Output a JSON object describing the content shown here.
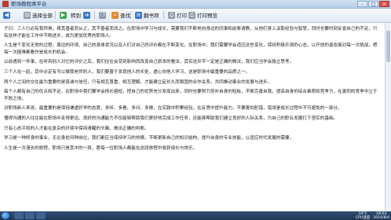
{
  "window": {
    "title": "职场教程类平台",
    "buttons": {
      "minimize": "–",
      "maximize": "□",
      "close": "×"
    }
  },
  "toolbar": {
    "buttons": [
      {
        "label": "",
        "icon": "back-icon"
      },
      {
        "label": "选择全部",
        "icon": "select-all-icon"
      },
      {
        "label": "",
        "icon": "forward-icon"
      },
      {
        "label": "转到",
        "icon": "goto-icon"
      },
      {
        "label": "",
        "icon": "copy-icon"
      },
      {
        "label": "",
        "icon": "search-icon"
      },
      {
        "label": "查找",
        "icon": "find-icon"
      },
      {
        "label": "",
        "icon": "bookmark-icon"
      },
      {
        "label": "翻书项",
        "icon": "page-icon"
      },
      {
        "label": "打印",
        "icon": "print-icon"
      },
      {
        "label": "打印预览",
        "icon": "print-preview-icon"
      }
    ]
  },
  "document": {
    "paragraphs": [
      "子曰：三人行必有我师焉，择其善者而从之，其不善者而改之。在职场中学习与成长，需要我们不断地向身边的同事和前辈请教，从他们身上汲取经验与智慧，同时也要时刻反省自己的不足，只有这样才能在工作中不断进步，成为更加优秀的职场人。",
      "人生是个变化无常的过程，周边的环境、自己的身体状况以及人们对自己的评价都在不断变化。在职场中，我们需要学会适应这些变化，保持积极乐观的心态，以开放的姿态面对每一次挑战，把每一次困难都看作是成长的机会。",
      "以前遇到一件事，在听到别人对它的评价之后，我们往往会受到影响而改变自己原本的看法，其实这并不一定是正确的做法，我们应当学会独立思考。",
      "三个人在一起，其中必定有可以做我老师的人，我们要善于发现他人的长处，虚心向他人学习，这是职场中最重要的品质之一。",
      "两个人之间的交往最为重要的是真诚与信任，只有相互尊重、相互理解，才能建立起长久而稳固的合作关系，共同推动事业的发展与进步。",
      "每个人都有自己的优点和不足，在职场中我们要学会扬长避短，把自己的优势充分发挥出来，同时也要努力弥补自身的短板，不断完善自我，提高自身的综合素质和竞争力，在激烈的竞争中立于不败之地。",
      "对职场新人来说，最重要的是保持谦虚好学的态度，多听、多看、多问、多做，在实践中积累经验，在反思中提升能力。不要害怕犯错，错误是成长过程中不可避免的一部分。",
      "懂得沟通的人往往能在职场中走得更远。良好的沟通能力不仅能够帮助我们更好地完成工作任务，还能够帮助我们建立良好的人际关系，为自己的职业发展打下坚实的基础。",
      "只有心态平和的人才能在复杂的环境中保持清醒的头脑，做出正确的判断。",
      "学习是一种终身的事业，无论身处何种岗位，我们都应当保持学习的热情，不断更新自己的知识结构，提升自身的专业技能，以适应时代发展的需要。",
      "人生是一次漫长的旅程，职场只是其中的一段，愿每一位职场人都能在这段旅程中收获成长与快乐。"
    ]
  },
  "taskbar": {
    "tray": {
      "temperature": "34°C",
      "temperature_label": "CPU温度",
      "time": "18:03",
      "date": "2016/8/4"
    }
  }
}
